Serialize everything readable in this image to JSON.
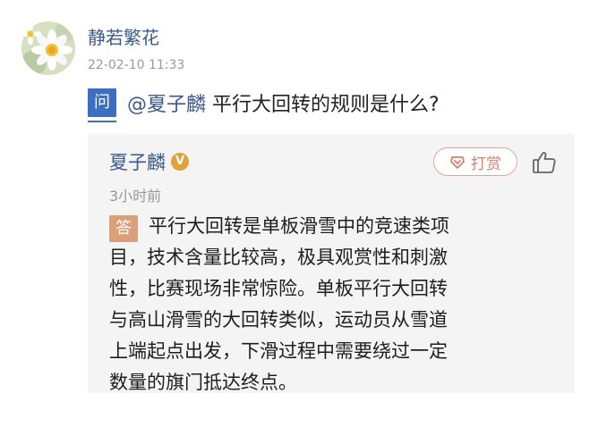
{
  "post": {
    "author": "静若繁花",
    "time": "22-02-10 11:33"
  },
  "question": {
    "badge": "问",
    "mention": "@夏子麟",
    "text": "平行大回转的规则是什么?"
  },
  "answer": {
    "answerer": "夏子麟",
    "verified_badge": "V",
    "tip_label": "打赏",
    "time": "3小时前",
    "badge": "答",
    "lines": [
      "平行大回转是单板滑雪中的竞速类项",
      "目，技术含量比较高，极具观赏性和刺激",
      "性，比赛现场非常惊险。单板平行大回转",
      "与高山滑雪的大回转类似，运动员从雪道",
      "上端起点出发，下滑过程中需要绕过一定",
      "数量的旗门抵达终点。"
    ]
  },
  "icons": {
    "avatar": "daisy-flower-image",
    "tip": "tip-gem-icon",
    "like": "thumbs-up-icon"
  },
  "colors": {
    "link_blue": "#3a5a8c",
    "question_badge": "#3d6fc0",
    "answer_badge": "#d9a07a",
    "tip_accent": "#d77f6e",
    "card_background": "#f4f4f4",
    "verified_gold": "#e0a33a"
  }
}
